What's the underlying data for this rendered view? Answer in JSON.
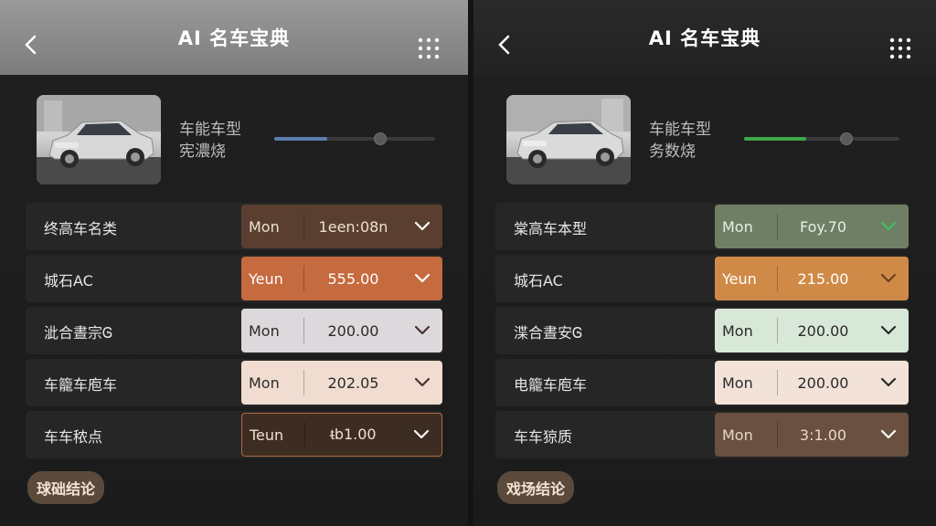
{
  "screens": [
    {
      "header": {
        "title": "AI 名车宝典"
      },
      "car": {
        "line1": "车能车型",
        "line2": "宪濃烧",
        "slider_value": 0.33,
        "slider_color": "#5b7fb0"
      },
      "rows": [
        {
          "label": "终高车名类",
          "unit": "Mon",
          "value": "1een:08n",
          "bg": "#5a3f30",
          "text": "#f0e0d0",
          "chev": "#ffffff"
        },
        {
          "label": "城石AC",
          "unit": "Yeun",
          "value": "555.00",
          "bg": "#c66a3f",
          "text": "#ffffff",
          "chev": "#ffffff"
        },
        {
          "label": "泚合晝宗Ꮆ",
          "unit": "Mon",
          "value": "200.00",
          "bg": "#dcd8dc",
          "text": "#2a2a2a",
          "chev": "#4a3030"
        },
        {
          "label": "车籠车庖车",
          "unit": "Mon",
          "value": "202.05",
          "bg": "#f0dcd0",
          "text": "#2a2a2a",
          "chev": "#4a3030"
        },
        {
          "label": "车车秾点",
          "unit": "Teun",
          "value": "ᵵb1.00",
          "bg": "#3d2c22",
          "text": "#f0e0d0",
          "chev": "#ffffff",
          "border": "#b06a3d"
        }
      ],
      "pill_label": "球础结论"
    },
    {
      "header": {
        "title": "AI 名车宝典"
      },
      "car": {
        "line1": "车能车型",
        "line2": "务数烧",
        "slider_value": 0.4,
        "slider_color": "#3fa84a"
      },
      "rows": [
        {
          "label": "棠高车本型",
          "unit": "Mon",
          "value": "Foy.70",
          "bg": "#6e7f66",
          "text": "#e6efe0",
          "chev": "#3cc060"
        },
        {
          "label": "城石AC",
          "unit": "Yeun",
          "value": "215.00",
          "bg": "#d08a48",
          "text": "#ffffff",
          "chev": "#6a4020"
        },
        {
          "label": "渫合晝安Ꮆ",
          "unit": "Mon",
          "value": "200.00",
          "bg": "#d8e8d8",
          "text": "#2a2a2a",
          "chev": "#2a2a2a"
        },
        {
          "label": "电籠车庖车",
          "unit": "Mon",
          "value": "200.00",
          "bg": "#f2e2d8",
          "text": "#2a2a2a",
          "chev": "#2a2a2a"
        },
        {
          "label": "车车猄质",
          "unit": "Mon",
          "value": "3:1.00",
          "bg": "#6a5040",
          "text": "#e8d8c8",
          "chev": "#ffffff"
        }
      ],
      "pill_label": "戏场结论"
    }
  ]
}
